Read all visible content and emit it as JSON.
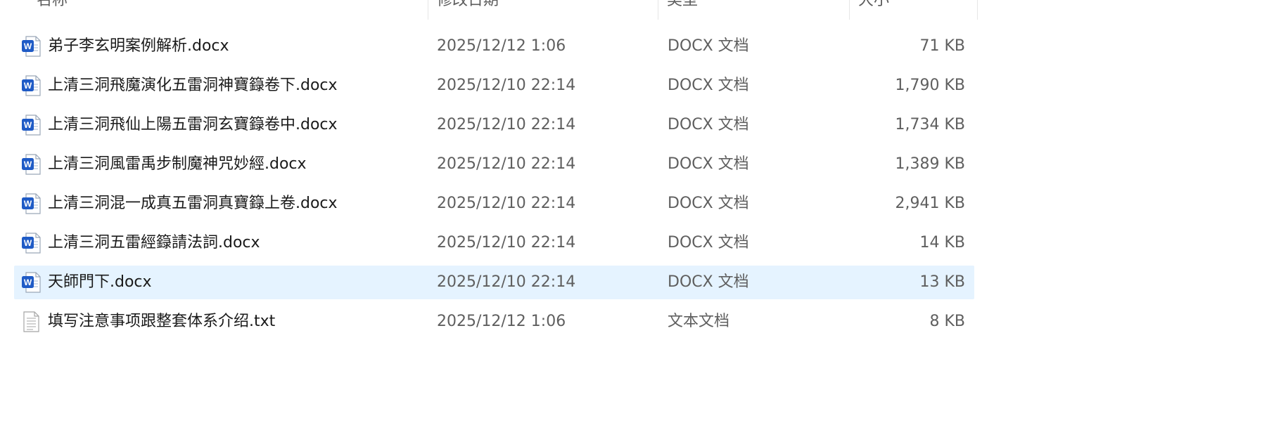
{
  "columns": {
    "name": "名称",
    "date": "修改日期",
    "type": "类型",
    "size": "大小"
  },
  "files": [
    {
      "name": "弟子李玄明案例解析.docx",
      "date": "2025/12/12 1:06",
      "type": "DOCX 文档",
      "size": "71 KB",
      "icon": "word-doc-icon",
      "selected": false
    },
    {
      "name": "上清三洞飛魔演化五雷洞神寶籙卷下.docx",
      "date": "2025/12/10 22:14",
      "type": "DOCX 文档",
      "size": "1,790 KB",
      "icon": "word-doc-icon",
      "selected": false
    },
    {
      "name": "上清三洞飛仙上陽五雷洞玄寶籙卷中.docx",
      "date": "2025/12/10 22:14",
      "type": "DOCX 文档",
      "size": "1,734 KB",
      "icon": "word-doc-icon",
      "selected": false
    },
    {
      "name": "上清三洞風雷禹步制魔神咒妙經.docx",
      "date": "2025/12/10 22:14",
      "type": "DOCX 文档",
      "size": "1,389 KB",
      "icon": "word-doc-icon",
      "selected": false
    },
    {
      "name": "上清三洞混一成真五雷洞真寶籙上卷.docx",
      "date": "2025/12/10 22:14",
      "type": "DOCX 文档",
      "size": "2,941 KB",
      "icon": "word-doc-icon",
      "selected": false
    },
    {
      "name": "上清三洞五雷經籙請法詞.docx",
      "date": "2025/12/10 22:14",
      "type": "DOCX 文档",
      "size": "14 KB",
      "icon": "word-doc-icon",
      "selected": false
    },
    {
      "name": "天師門下.docx",
      "date": "2025/12/10 22:14",
      "type": "DOCX 文档",
      "size": "13 KB",
      "icon": "word-doc-icon",
      "selected": true
    },
    {
      "name": "填写注意事项跟整套体系介绍.txt",
      "date": "2025/12/12 1:06",
      "type": "文本文档",
      "size": "8 KB",
      "icon": "text-doc-icon",
      "selected": false
    }
  ]
}
